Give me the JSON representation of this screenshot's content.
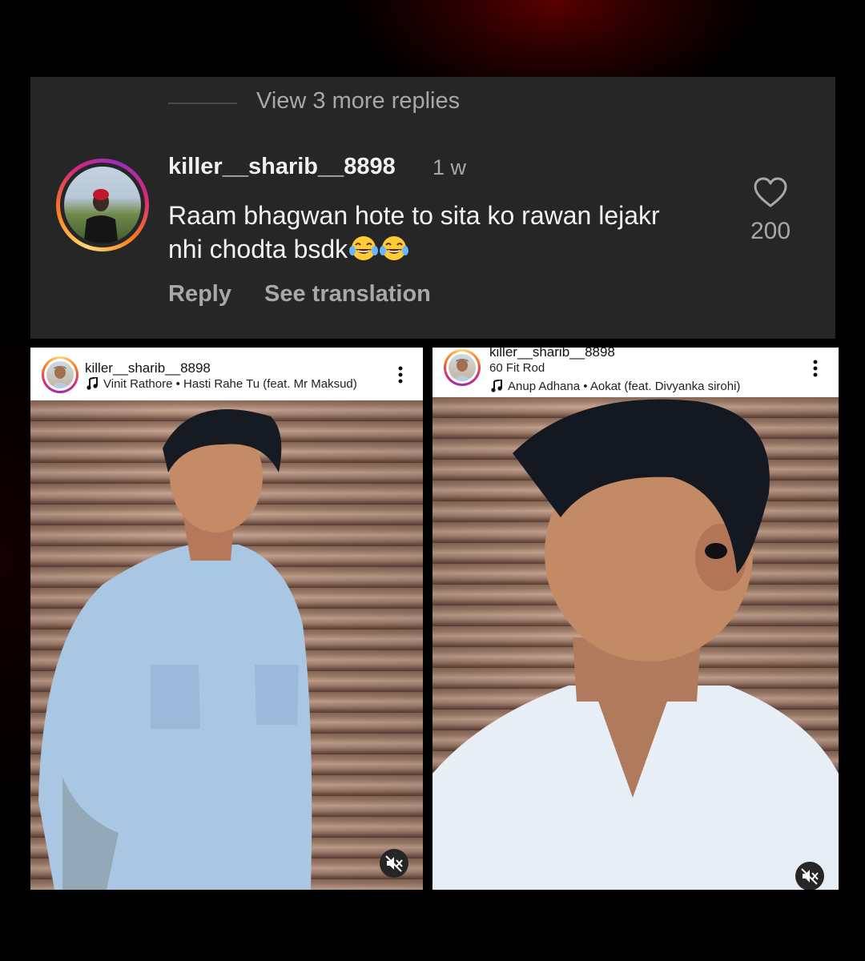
{
  "comment": {
    "view_replies": "View 3 more replies",
    "username": "killer__sharib__8898",
    "timestamp": "1 w",
    "text_line1": "Raam bhagwan hote to sita ko rawan lejakr",
    "text_line2": "nhi chodta bsdk",
    "emojis": [
      "face-with-tears-of-joy",
      "face-with-tears-of-joy"
    ],
    "reply_label": "Reply",
    "translation_label": "See translation",
    "like_count": "200",
    "icons": {
      "like": "heart-icon"
    }
  },
  "posts": [
    {
      "username": "killer__sharib__8898",
      "location": "",
      "music": "Vinit Rathore • Hasti Rahe Tu (feat. Mr Maksud)",
      "icons": [
        "music-note-icon",
        "more-options-icon",
        "muted-speaker-icon"
      ]
    },
    {
      "username": "killer__sharib__8898",
      "location": "60 Fit Rod",
      "music": "Anup Adhana • Aokat (feat. Divyanka sirohi)",
      "icons": [
        "music-note-icon",
        "more-options-icon",
        "muted-speaker-icon"
      ]
    }
  ],
  "colors": {
    "card_bg": "#262626",
    "primary_text": "#f2f2f2",
    "secondary_text": "#a8a8a8",
    "story_ring": [
      "#feda75",
      "#fa7e1e",
      "#d62976",
      "#962fbf"
    ]
  }
}
